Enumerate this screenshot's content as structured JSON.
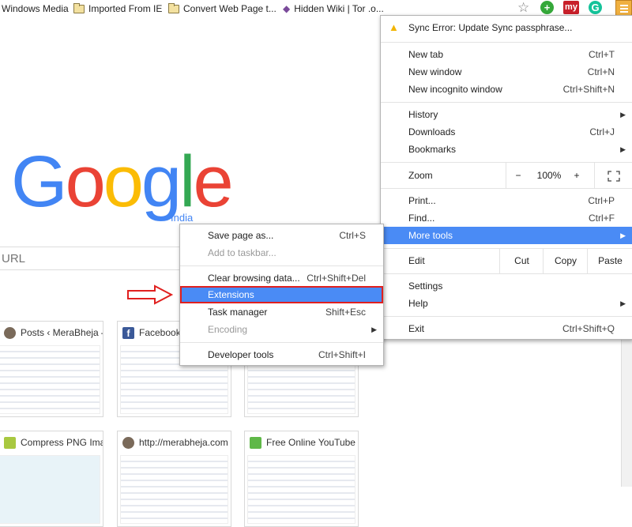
{
  "bookmarks": [
    "Windows Media",
    "Imported From IE",
    "Convert Web Page t...",
    "Hidden Wiki | Tor .o..."
  ],
  "extensions": {
    "my_label": "my",
    "g_label": "G",
    "plus_label": "+"
  },
  "logo": {
    "letters": [
      "G",
      "o",
      "o",
      "g",
      "l",
      "e"
    ],
    "colors": [
      "#4285f4",
      "#ea4335",
      "#fbbc05",
      "#4285f4",
      "#34a853",
      "#ea4335"
    ],
    "region": "India"
  },
  "search": {
    "placeholder": "URL"
  },
  "tiles": [
    {
      "title": "Posts ‹ MeraBheja —",
      "fav_color": "#7a6a5a"
    },
    {
      "title": "Facebook",
      "fav_color": "#3b5998",
      "fav_letter": "f"
    },
    {
      "title": "",
      "fav_color": "#ffffff"
    },
    {
      "title": "Compress PNG Images",
      "fav_color": "#a8c840"
    },
    {
      "title": "http://merabheja.com",
      "fav_color": "#7a6a5a"
    },
    {
      "title": "Free Online YouTube",
      "fav_color": "#5fb848"
    }
  ],
  "main_menu": {
    "sync_error": "Sync Error: Update Sync passphrase...",
    "new_tab": {
      "label": "New tab",
      "shortcut": "Ctrl+T"
    },
    "new_window": {
      "label": "New window",
      "shortcut": "Ctrl+N"
    },
    "new_incognito": {
      "label": "New incognito window",
      "shortcut": "Ctrl+Shift+N"
    },
    "history": {
      "label": "History"
    },
    "downloads": {
      "label": "Downloads",
      "shortcut": "Ctrl+J"
    },
    "bookmarks": {
      "label": "Bookmarks"
    },
    "zoom": {
      "label": "Zoom",
      "minus": "−",
      "value": "100%",
      "plus": "+"
    },
    "print": {
      "label": "Print...",
      "shortcut": "Ctrl+P"
    },
    "find": {
      "label": "Find...",
      "shortcut": "Ctrl+F"
    },
    "more_tools": {
      "label": "More tools"
    },
    "edit": {
      "label": "Edit",
      "cut": "Cut",
      "copy": "Copy",
      "paste": "Paste"
    },
    "settings": {
      "label": "Settings"
    },
    "help": {
      "label": "Help"
    },
    "exit": {
      "label": "Exit",
      "shortcut": "Ctrl+Shift+Q"
    }
  },
  "submenu": {
    "save_page": {
      "label": "Save page as...",
      "shortcut": "Ctrl+S"
    },
    "add_taskbar": {
      "label": "Add to taskbar..."
    },
    "clear_data": {
      "label": "Clear browsing data...",
      "shortcut": "Ctrl+Shift+Del"
    },
    "extensions": {
      "label": "Extensions"
    },
    "task_manager": {
      "label": "Task manager",
      "shortcut": "Shift+Esc"
    },
    "encoding": {
      "label": "Encoding"
    },
    "dev_tools": {
      "label": "Developer tools",
      "shortcut": "Ctrl+Shift+I"
    }
  },
  "colors": {
    "highlight": "#4a8bf5",
    "annotation_red": "#e0201f",
    "warning": "#f2b400"
  }
}
